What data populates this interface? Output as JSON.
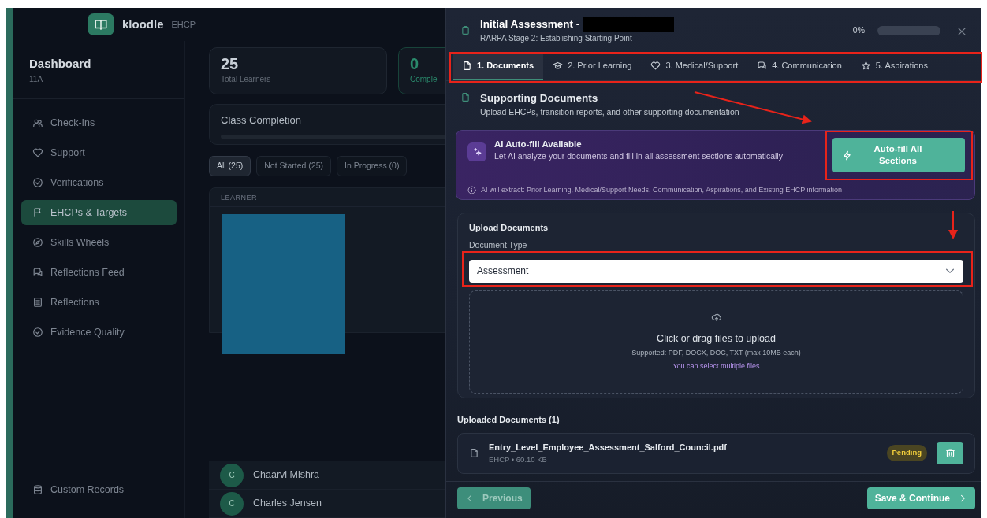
{
  "brand": {
    "name": "kloodle",
    "product": "EHCP"
  },
  "sidebar": {
    "title": "Dashboard",
    "subtitle": "11A",
    "items": [
      {
        "label": "Check-Ins",
        "selected": false
      },
      {
        "label": "Support",
        "selected": false
      },
      {
        "label": "Verifications",
        "selected": false
      },
      {
        "label": "EHCPs & Targets",
        "selected": true
      },
      {
        "label": "Skills Wheels",
        "selected": false
      },
      {
        "label": "Reflections Feed",
        "selected": false
      },
      {
        "label": "Reflections",
        "selected": false
      },
      {
        "label": "Evidence Quality",
        "selected": false
      }
    ],
    "footer_item": {
      "label": "Custom Records"
    }
  },
  "stats": [
    {
      "value": "25",
      "label": "Total Learners",
      "kind": "plain"
    },
    {
      "value": "0",
      "label": "Comple",
      "kind": "accent"
    }
  ],
  "class_completion": {
    "title": "Class Completion",
    "level": 0
  },
  "filters": [
    {
      "label": "All (25)",
      "selected": true
    },
    {
      "label": "Not Started (25)",
      "selected": false
    },
    {
      "label": "In Progress (0)",
      "selected": false
    }
  ],
  "table": {
    "columns": [
      "LEARNER"
    ],
    "rows": [
      {
        "initial": "C",
        "name": "Chaarvi Mishra"
      },
      {
        "initial": "C",
        "name": "Charles Jensen"
      }
    ]
  },
  "modal": {
    "title": "Initial Assessment -",
    "subtitle": "RARPA Stage 2: Establishing Starting Point",
    "progress_text": "0%",
    "progress": {
      "level": 0
    },
    "tabs": [
      {
        "label": "1. Documents",
        "selected": true
      },
      {
        "label": "2. Prior Learning",
        "selected": false
      },
      {
        "label": "3. Medical/Support",
        "selected": false
      },
      {
        "label": "4. Communication",
        "selected": false
      },
      {
        "label": "5. Aspirations",
        "selected": false
      }
    ],
    "section": {
      "title": "Supporting Documents",
      "description": "Upload EHCPs, transition reports, and other supporting documentation"
    },
    "ai_card": {
      "title": "AI Auto-fill Available",
      "description": "Let AI analyze your documents and fill in all assessment sections automatically",
      "button": "Auto-fill All Sections",
      "note": "AI will extract: Prior Learning, Medical/Support Needs, Communication, Aspirations, and Existing EHCP information"
    },
    "upload": {
      "title": "Upload Documents",
      "field_label": "Document Type",
      "field_value": "Assessment",
      "drop_title": "Click or drag files to upload",
      "drop_supported": "Supported: PDF, DOCX, DOC, TXT (max 10MB each)",
      "drop_hint": "You can select multiple files"
    },
    "uploaded_title": "Uploaded Documents (1)",
    "files": [
      {
        "name": "Entry_Level_Employee_Assessment_Salford_Council.pdf",
        "meta": "EHCP • 60.10 KB",
        "status": "Pending"
      }
    ],
    "footer": {
      "previous": {
        "label": "Previous",
        "disabled": true
      },
      "next": {
        "label": "Save & Continue",
        "disabled": false
      }
    }
  }
}
